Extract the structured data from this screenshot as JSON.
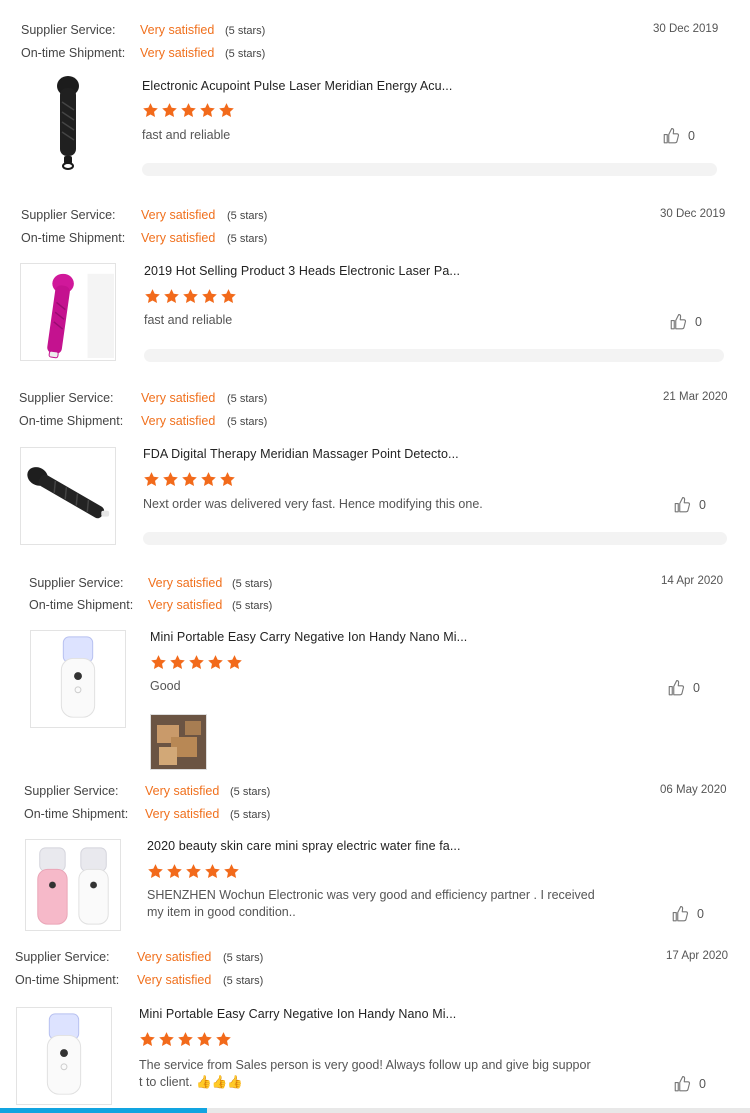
{
  "labels": {
    "supplier_service": "Supplier Service:",
    "ontime_shipment": "On-time Shipment:",
    "rating_value": "Very satisfied",
    "rating_stars": "(5 stars)"
  },
  "reviews": [
    {
      "date": "30 Dec 2019",
      "product": "Electronic Acupoint Pulse Laser Meridian Energy Acu...",
      "rating": 5,
      "text": "fast and reliable",
      "likes": "0",
      "image": "black-wand-massager"
    },
    {
      "date": "30 Dec 2019",
      "product": "2019 Hot Selling Product 3 Heads Electronic Laser Pa...",
      "rating": 5,
      "text": "fast and reliable",
      "likes": "0",
      "image": "pink-wand-massager"
    },
    {
      "date": "21 Mar 2020",
      "product": "FDA Digital Therapy Meridian Massager Point Detecto...",
      "rating": 5,
      "text": "Next order was delivered very fast. Hence modifying this one.",
      "likes": "0",
      "image": "black-wand-massager-diagonal"
    },
    {
      "date": "14 Apr 2020",
      "product": "Mini Portable Easy Carry Negative Ion Handy Nano Mi...",
      "rating": 5,
      "text": "Good",
      "likes": "0",
      "image": "white-nano-mister",
      "photo": "cardboard-boxes-photo"
    },
    {
      "date": "06 May 2020",
      "product": "2020 beauty skin care mini spray electric water fine fa...",
      "rating": 5,
      "text": "SHENZHEN Wochun Electronic was very good and efficiency partner . I received\nmy item in good condition..",
      "likes": "0",
      "image": "pink-white-mister-pair"
    },
    {
      "date": "17 Apr 2020",
      "product": "Mini Portable Easy Carry Negative Ion Handy Nano Mi...",
      "rating": 5,
      "text": "The service from Sales person is very good! Always follow up and give big suppor\nt to client.",
      "text_emoji": "👍👍👍",
      "likes": "0",
      "image": "white-nano-mister"
    }
  ],
  "colors": {
    "accent": "#f0701d",
    "star": "#f26a1b",
    "progress": "#12a4e0"
  }
}
